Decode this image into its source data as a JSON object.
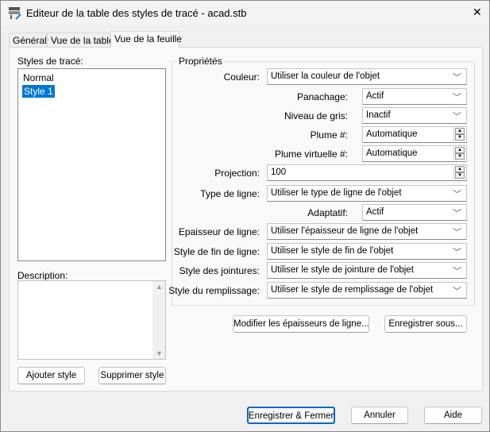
{
  "window": {
    "title": "Editeur de la table des styles de tracé - acad.stb",
    "close": "✕"
  },
  "tabs": [
    {
      "label": "Général"
    },
    {
      "label": "Vue de la table"
    },
    {
      "label": "Vue de la feuille"
    }
  ],
  "styles": {
    "label": "Styles de tracé:",
    "items": [
      "Normal",
      "Style 1"
    ],
    "selected": "Style 1"
  },
  "description": {
    "label": "Description:",
    "value": ""
  },
  "left_buttons": {
    "add": "Ajouter style",
    "delete": "Supprimer style"
  },
  "properties": {
    "title": "Propriétés",
    "color": {
      "label": "Couleur:",
      "value": "Utiliser la couleur de l'objet"
    },
    "dither": {
      "label": "Panachage:",
      "value": "Actif"
    },
    "grayscale": {
      "label": "Niveau de gris:",
      "value": "Inactif"
    },
    "pen": {
      "label": "Plume #:",
      "value": "Automatique"
    },
    "virtual_pen": {
      "label": "Plume virtuelle #:",
      "value": "Automatique"
    },
    "screening": {
      "label": "Projection:",
      "value": "100"
    },
    "linetype": {
      "label": "Type de ligne:",
      "value": "Utiliser le type de ligne de l'objet"
    },
    "adaptive": {
      "label": "Adaptatif:",
      "value": "Actif"
    },
    "lineweight": {
      "label": "Epaisseur de ligne:",
      "value": "Utiliser l'épaisseur de ligne de l'objet"
    },
    "line_end": {
      "label": "Style de fin de ligne:",
      "value": "Utiliser le style de fin de l'objet"
    },
    "line_join": {
      "label": "Style des jointures:",
      "value": "Utiliser le style de jointure de l'objet"
    },
    "fill": {
      "label": "Style du remplissage:",
      "value": "Utiliser le style de remplissage de l'objet"
    }
  },
  "mid_buttons": {
    "edit_lineweights": "Modifier les épaisseurs de ligne...",
    "save_as": "Enregistrer sous..."
  },
  "footer": {
    "save_close": "Enregistrer & Fermer",
    "cancel": "Annuler",
    "help": "Aide"
  }
}
